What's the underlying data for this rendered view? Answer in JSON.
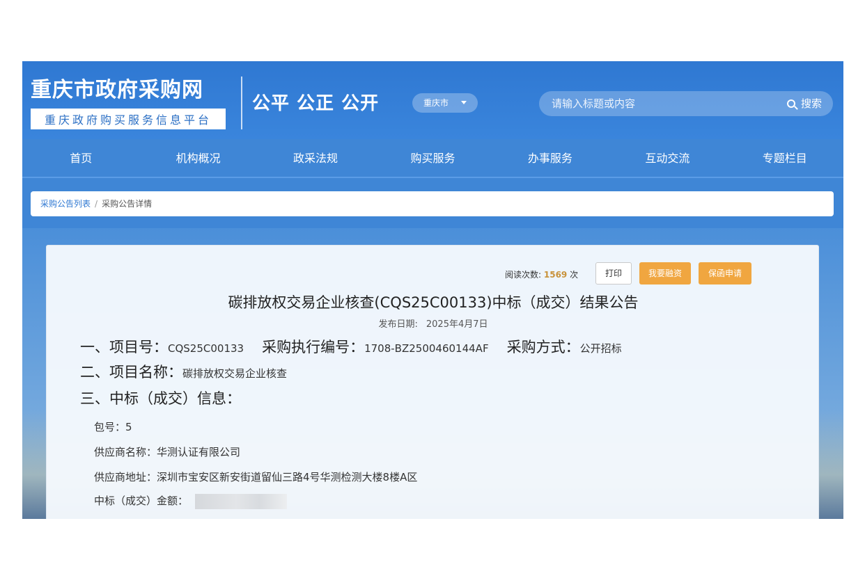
{
  "header": {
    "site_title": "重庆市政府采购网",
    "site_subtitle": "重庆政府购买服务信息平台",
    "slogan": "公平 公正 公开",
    "city_select": "重庆市",
    "search": {
      "placeholder": "请输入标题或内容",
      "button_label": "搜索"
    }
  },
  "nav": {
    "items": [
      {
        "label": "首页"
      },
      {
        "label": "机构概况"
      },
      {
        "label": "政采法规"
      },
      {
        "label": "购买服务"
      },
      {
        "label": "办事服务"
      },
      {
        "label": "互动交流"
      },
      {
        "label": "专题栏目"
      }
    ]
  },
  "breadcrumb": {
    "link": "采购公告列表",
    "separator": "/",
    "current": "采购公告详情"
  },
  "notice": {
    "read_label": "阅读次数:",
    "read_count": "1569",
    "read_unit": "次",
    "print_label": "打印",
    "finance_label": "我要融资",
    "guarantee_label": "保函申请",
    "title": "碳排放权交易企业核查(CQS25C00133)中标（成交）结果公告",
    "publish_label": "发布日期:",
    "publish_date": "2025年4月7日",
    "sec1": {
      "project_no_label": "一、项目号：",
      "project_no": "CQS25C00133",
      "exec_no_label": "采购执行编号：",
      "exec_no": "1708-BZ2500460144AF",
      "method_label": "采购方式：",
      "method": "公开招标"
    },
    "sec2": {
      "label": "二、项目名称：",
      "value": "碳排放权交易企业核查"
    },
    "sec3": {
      "label": "三、中标（成交）信息："
    },
    "fields": {
      "package_label": "包号：",
      "package_value": "5",
      "supplier_label": "供应商名称：",
      "supplier_value": "华测认证有限公司",
      "address_label": "供应商地址：",
      "address_value": "深圳市宝安区新安街道留仙三路4号华测检测大楼8楼A区",
      "amount_label": "中标（成交）金额："
    }
  },
  "colors": {
    "primary": "#2f78d2",
    "accent": "#f0a640",
    "read_count": "#c8923a"
  }
}
